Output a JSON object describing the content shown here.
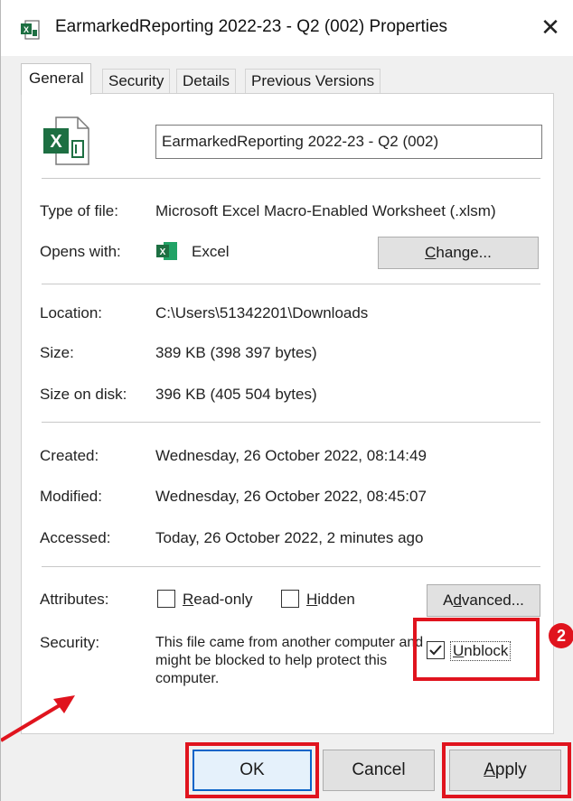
{
  "window": {
    "title": "EarmarkedReporting 2022-23 - Q2 (002) Properties",
    "close_glyph": "✕"
  },
  "tabs": [
    {
      "label": "General",
      "active": true
    },
    {
      "label": "Security",
      "active": false
    },
    {
      "label": "Details",
      "active": false
    },
    {
      "label": "Previous Versions",
      "active": false
    }
  ],
  "general": {
    "file_name": "EarmarkedReporting 2022-23 - Q2 (002)",
    "type_label": "Type of file:",
    "type_value": "Microsoft Excel Macro-Enabled Worksheet (.xlsm)",
    "opens_label": "Opens with:",
    "opens_value": "Excel",
    "change_button": {
      "prefix": "",
      "underlined": "C",
      "suffix": "hange..."
    },
    "location_label": "Location:",
    "location_value": "C:\\Users\\51342201\\Downloads",
    "size_label": "Size:",
    "size_value": "389 KB (398 397 bytes)",
    "size_disk_label": "Size on disk:",
    "size_disk_value": "396 KB (405 504 bytes)",
    "created_label": "Created:",
    "created_value": "Wednesday, 26 October 2022, 08:14:49",
    "modified_label": "Modified:",
    "modified_value": "Wednesday, 26 October 2022, 08:45:07",
    "accessed_label": "Accessed:",
    "accessed_value": "Today, 26 October 2022, 2 minutes ago",
    "attributes_label": "Attributes:",
    "readonly": {
      "underlined": "R",
      "rest": "ead-only",
      "checked": false
    },
    "hidden": {
      "underlined": "H",
      "rest": "idden",
      "checked": false
    },
    "advanced_button": {
      "prefix": "A",
      "underlined": "d",
      "suffix": "vanced..."
    },
    "security_label": "Security:",
    "security_text": "This file came from another computer and might be blocked to help protect this computer.",
    "unblock": {
      "underlined": "U",
      "rest": "nblock",
      "checked": true
    }
  },
  "footer": {
    "ok_label": "OK",
    "cancel_label": "Cancel",
    "apply_button": {
      "underlined": "A",
      "rest": "pply"
    }
  },
  "annotations": {
    "badge_number": "2",
    "highlight_color": "#e0141e"
  },
  "colors": {
    "excel_green": "#1d6f42",
    "default_button_border": "#0a64c8"
  },
  "icons": {
    "title": "excel-file-icon",
    "file": "excel-document-icon",
    "opens_with": "excel-app-icon",
    "close": "close-icon",
    "checkmark": "checkmark-icon",
    "arrow": "red-arrow-icon"
  }
}
